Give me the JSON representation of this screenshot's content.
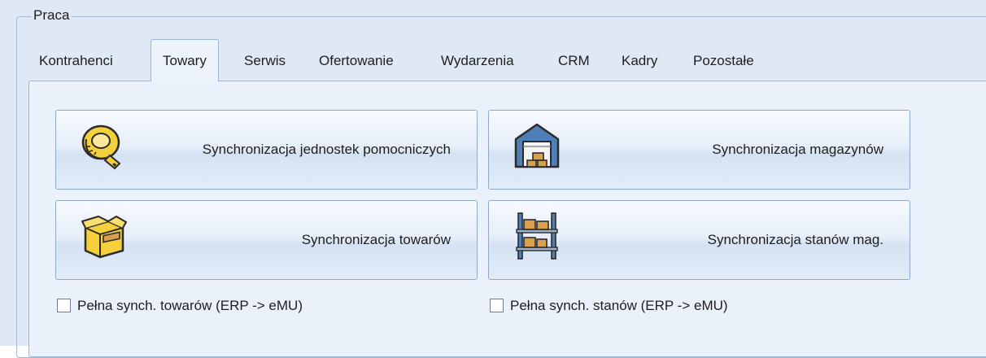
{
  "group": {
    "title": "Praca"
  },
  "tabs": [
    {
      "label": "Kontrahenci",
      "active": false
    },
    {
      "label": "Towary",
      "active": true
    },
    {
      "label": "Serwis",
      "active": false
    },
    {
      "label": "Ofertowanie",
      "active": false
    },
    {
      "label": "Wydarzenia",
      "active": false
    },
    {
      "label": "CRM",
      "active": false
    },
    {
      "label": "Kadry",
      "active": false
    },
    {
      "label": "Pozostałe",
      "active": false
    }
  ],
  "buttons": {
    "units": {
      "label": "Synchronizacja jednostek pomocniczych",
      "icon": "measuring-tape-icon"
    },
    "warehouses": {
      "label": "Synchronizacja magazynów",
      "icon": "warehouse-icon"
    },
    "goods": {
      "label": "Synchronizacja towarów",
      "icon": "box-icon"
    },
    "stock": {
      "label": "Synchronizacja stanów mag.",
      "icon": "shelf-icon"
    }
  },
  "checkboxes": {
    "full_goods": {
      "label": "Pełna synch. towarów (ERP -> eMU)",
      "checked": false
    },
    "full_stock": {
      "label": "Pełna synch. stanów (ERP -> eMU)",
      "checked": false
    }
  },
  "colors": {
    "background": "#dfe9f5",
    "panel": "#ebf1fa",
    "border": "#9db4d3",
    "icon_yellow": "#f4d03c",
    "icon_blue": "#4f7fb5",
    "icon_box": "#d9a050"
  }
}
